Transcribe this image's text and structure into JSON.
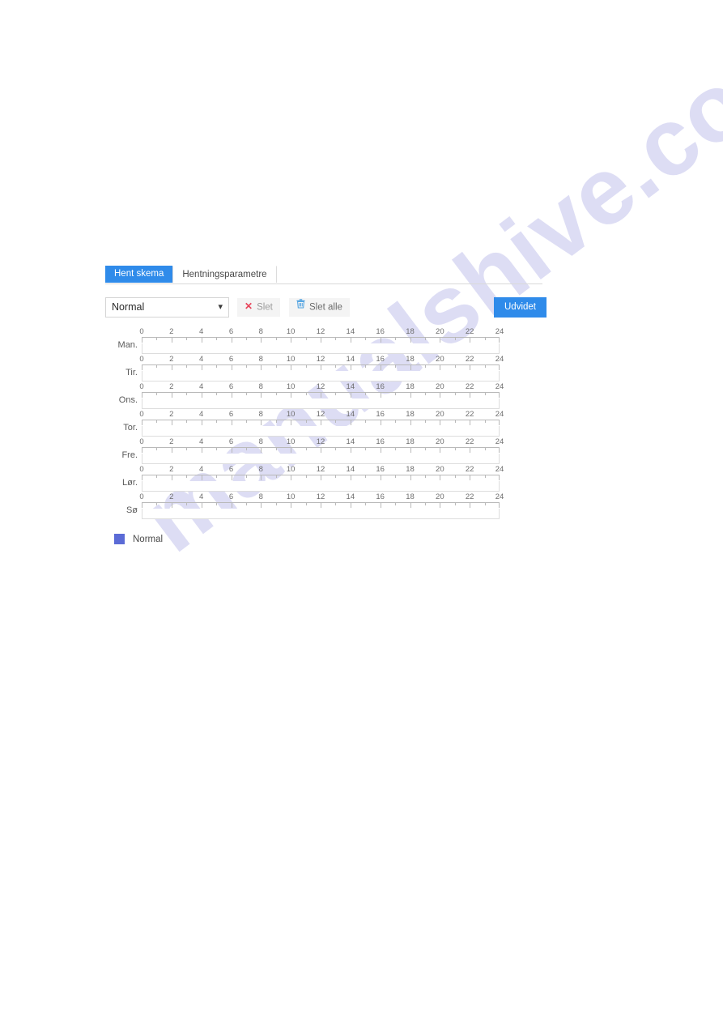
{
  "watermark": {
    "text": "manualshive.com"
  },
  "tabs": [
    {
      "label": "Hent skema",
      "active": true
    },
    {
      "label": "Hentningsparametre",
      "active": false
    }
  ],
  "toolbar": {
    "schedule_type": {
      "value": "Normal",
      "options": [
        "Normal"
      ]
    },
    "chevron": "chevron-down-icon",
    "delete_label": "Slet",
    "delete_icon": "x-icon",
    "delete_all_label": "Slet alle",
    "delete_all_icon": "trash-icon",
    "advanced_label": "Udvidet"
  },
  "schedule": {
    "hour_labels": [
      "0",
      "2",
      "4",
      "6",
      "8",
      "10",
      "12",
      "14",
      "16",
      "18",
      "20",
      "22",
      "24"
    ],
    "hour_min": 0,
    "hour_max": 24,
    "days": [
      {
        "label": "Man.",
        "segments": []
      },
      {
        "label": "Tir.",
        "segments": []
      },
      {
        "label": "Ons.",
        "segments": []
      },
      {
        "label": "Tor.",
        "segments": []
      },
      {
        "label": "Fre.",
        "segments": []
      },
      {
        "label": "Lør.",
        "segments": []
      },
      {
        "label": "Sø",
        "segments": []
      }
    ]
  },
  "legend": [
    {
      "label": "Normal",
      "color": "#5b6bd6"
    }
  ],
  "colors": {
    "accent": "#2f8bea",
    "normal": "#5b6bd6",
    "delete_x": "#e8445a",
    "trash": "#4a9fe0"
  }
}
